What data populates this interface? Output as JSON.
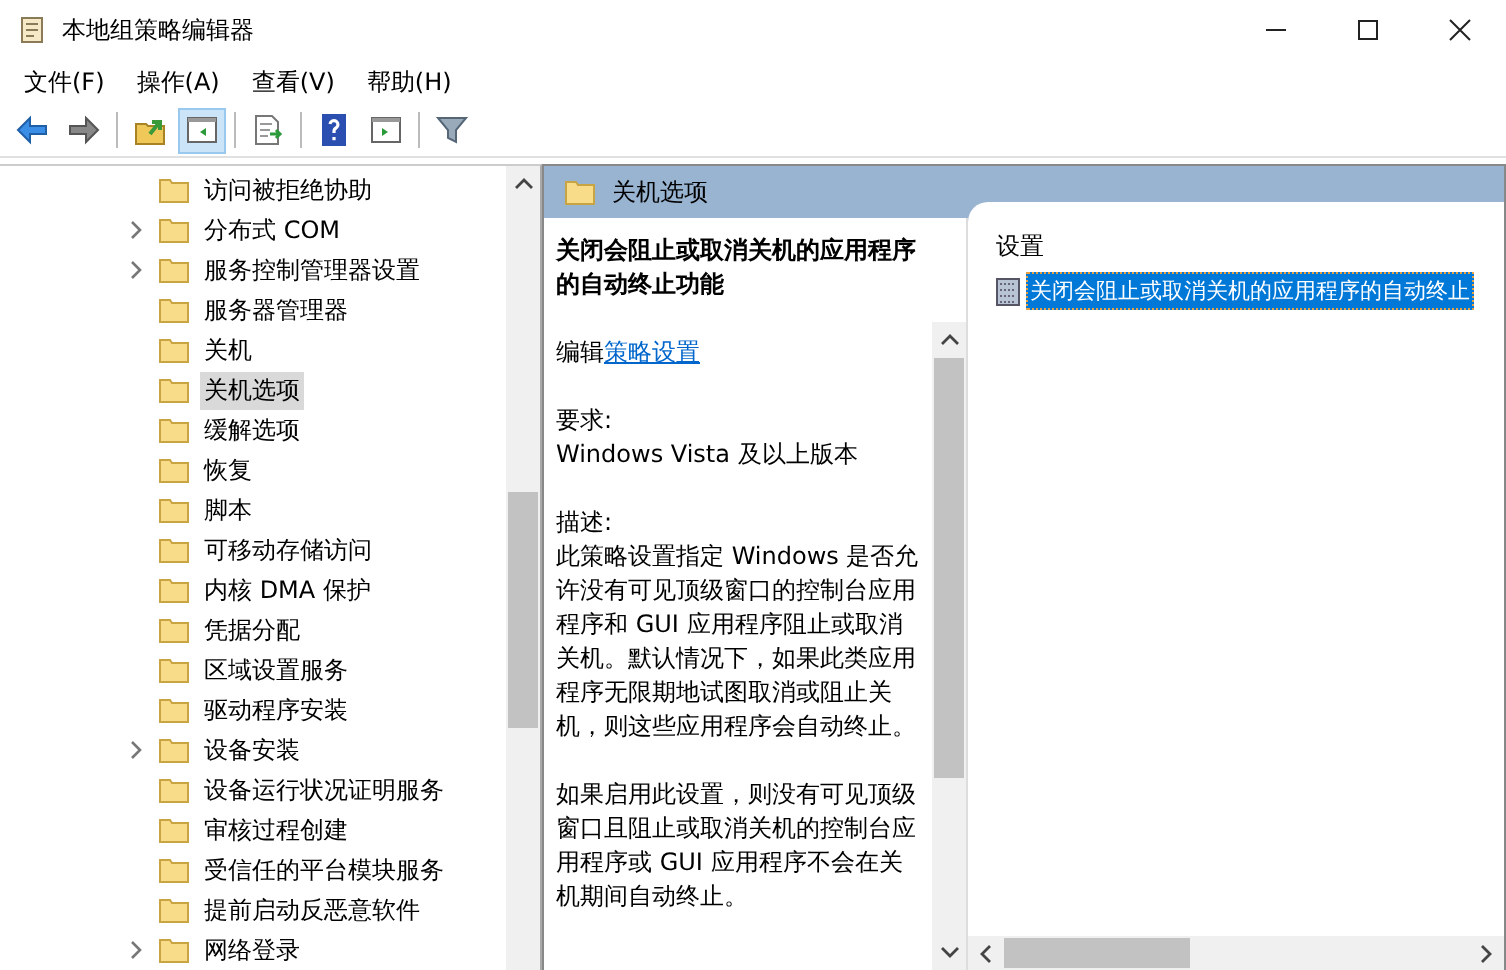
{
  "window": {
    "title": "本地组策略编辑器"
  },
  "menu": [
    "文件(F)",
    "操作(A)",
    "查看(V)",
    "帮助(H)"
  ],
  "toolbar": [
    [
      {
        "kind": "back",
        "selected": false
      },
      {
        "kind": "forward",
        "selected": false
      }
    ],
    [
      {
        "kind": "up",
        "selected": false
      },
      {
        "kind": "tree",
        "selected": true
      }
    ],
    [
      {
        "kind": "export",
        "selected": false
      }
    ],
    [
      {
        "kind": "help",
        "selected": false
      },
      {
        "kind": "pane",
        "selected": false
      }
    ],
    [
      {
        "kind": "filter",
        "selected": false
      }
    ]
  ],
  "tree": [
    {
      "label": "访问被拒绝协助",
      "expandable": false,
      "selected": false
    },
    {
      "label": "分布式 COM",
      "expandable": true,
      "selected": false
    },
    {
      "label": "服务控制管理器设置",
      "expandable": true,
      "selected": false
    },
    {
      "label": "服务器管理器",
      "expandable": false,
      "selected": false
    },
    {
      "label": "关机",
      "expandable": false,
      "selected": false
    },
    {
      "label": "关机选项",
      "expandable": false,
      "selected": true
    },
    {
      "label": "缓解选项",
      "expandable": false,
      "selected": false
    },
    {
      "label": "恢复",
      "expandable": false,
      "selected": false
    },
    {
      "label": "脚本",
      "expandable": false,
      "selected": false
    },
    {
      "label": "可移动存储访问",
      "expandable": false,
      "selected": false
    },
    {
      "label": "内核 DMA 保护",
      "expandable": false,
      "selected": false
    },
    {
      "label": "凭据分配",
      "expandable": false,
      "selected": false
    },
    {
      "label": "区域设置服务",
      "expandable": false,
      "selected": false
    },
    {
      "label": "驱动程序安装",
      "expandable": false,
      "selected": false
    },
    {
      "label": "设备安装",
      "expandable": true,
      "selected": false
    },
    {
      "label": "设备运行状况证明服务",
      "expandable": false,
      "selected": false
    },
    {
      "label": "审核过程创建",
      "expandable": false,
      "selected": false
    },
    {
      "label": "受信任的平台模块服务",
      "expandable": false,
      "selected": false
    },
    {
      "label": "提前启动反恶意软件",
      "expandable": false,
      "selected": false
    },
    {
      "label": "网络登录",
      "expandable": true,
      "selected": false
    }
  ],
  "details": {
    "header": "关机选项",
    "policy_title": "关闭会阻止或取消关机的应用程序的自动终止功能",
    "edit_prefix": "编辑",
    "edit_link": "策略设置",
    "requirements_label": "要求:",
    "requirements": "Windows Vista 及以上版本",
    "description_label": "描述:",
    "paragraphs": [
      "此策略设置指定 Windows 是否允许没有可见顶级窗口的控制台应用程序和 GUI 应用程序阻止或取消关机。默认情况下，如果此类应用程序无限期地试图取消或阻止关机，则这些应用程序会自动终止。",
      "如果启用此设置，则没有可见顶级窗口且阻止或取消关机的控制台应用程序或 GUI 应用程序不会在关机期间自动终止。"
    ]
  },
  "settings": {
    "column": "设置",
    "rows": [
      {
        "text": "关闭会阻止或取消关机的应用程序的自动终止",
        "selected": true
      }
    ]
  }
}
